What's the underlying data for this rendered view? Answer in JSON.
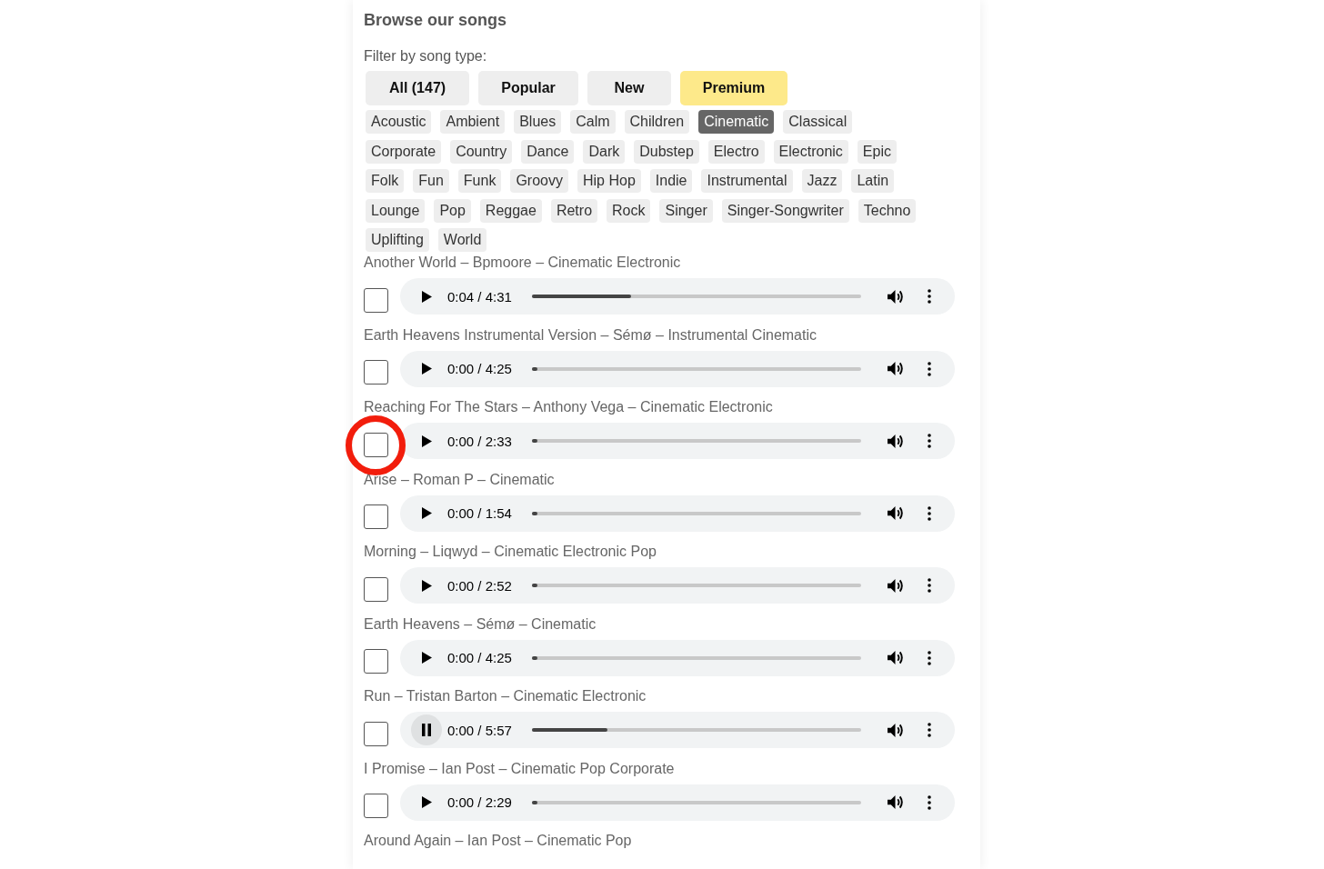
{
  "heading": "Browse our songs",
  "filter_label": "Filter by song type:",
  "type_buttons": [
    {
      "label": "All (147)",
      "selected": false
    },
    {
      "label": "Popular",
      "selected": false
    },
    {
      "label": "New",
      "selected": false
    },
    {
      "label": "Premium",
      "selected": true
    }
  ],
  "genre_rows": [
    [
      {
        "label": "Acoustic",
        "selected": false
      },
      {
        "label": "Ambient",
        "selected": false
      },
      {
        "label": "Blues",
        "selected": false
      },
      {
        "label": "Calm",
        "selected": false
      },
      {
        "label": "Children",
        "selected": false
      },
      {
        "label": "Cinematic",
        "selected": true
      },
      {
        "label": "Classical",
        "selected": false
      }
    ],
    [
      {
        "label": "Corporate",
        "selected": false
      },
      {
        "label": "Country",
        "selected": false
      },
      {
        "label": "Dance",
        "selected": false
      },
      {
        "label": "Dark",
        "selected": false
      },
      {
        "label": "Dubstep",
        "selected": false
      },
      {
        "label": "Electro",
        "selected": false
      },
      {
        "label": "Electronic",
        "selected": false
      },
      {
        "label": "Epic",
        "selected": false
      }
    ],
    [
      {
        "label": "Folk",
        "selected": false
      },
      {
        "label": "Fun",
        "selected": false
      },
      {
        "label": "Funk",
        "selected": false
      },
      {
        "label": "Groovy",
        "selected": false
      },
      {
        "label": "Hip Hop",
        "selected": false
      },
      {
        "label": "Indie",
        "selected": false
      },
      {
        "label": "Instrumental",
        "selected": false
      },
      {
        "label": "Jazz",
        "selected": false
      },
      {
        "label": "Latin",
        "selected": false
      }
    ],
    [
      {
        "label": "Lounge",
        "selected": false
      },
      {
        "label": "Pop",
        "selected": false
      },
      {
        "label": "Reggae",
        "selected": false
      },
      {
        "label": "Retro",
        "selected": false
      },
      {
        "label": "Rock",
        "selected": false
      },
      {
        "label": "Singer",
        "selected": false
      },
      {
        "label": "Singer-Songwriter",
        "selected": false
      },
      {
        "label": "Techno",
        "selected": false
      }
    ],
    [
      {
        "label": "Uplifting",
        "selected": false
      },
      {
        "label": "World",
        "selected": false
      }
    ]
  ],
  "songs": [
    {
      "title": "Another World – Bpmoore – Cinematic Electronic",
      "checked": false,
      "circled": false,
      "playing": false,
      "time": "0:04 / 4:31",
      "level": 0.3
    },
    {
      "title": "Earth Heavens Instrumental Version – Sémø – Instrumental Cinematic",
      "checked": false,
      "circled": false,
      "playing": false,
      "time": "0:00 / 4:25",
      "level": 0.01
    },
    {
      "title": "Reaching For The Stars – Anthony Vega – Cinematic Electronic",
      "checked": false,
      "circled": true,
      "playing": false,
      "time": "0:00 / 2:33",
      "level": 0.01
    },
    {
      "title": "Arise – Roman P – Cinematic",
      "checked": false,
      "circled": false,
      "playing": false,
      "time": "0:00 / 1:54",
      "level": 0.01
    },
    {
      "title": "Morning – Liqwyd – Cinematic Electronic Pop",
      "checked": false,
      "circled": false,
      "playing": false,
      "time": "0:00 / 2:52",
      "level": 0.01
    },
    {
      "title": "Earth Heavens – Sémø – Cinematic",
      "checked": false,
      "circled": false,
      "playing": false,
      "time": "0:00 / 4:25",
      "level": 0.01
    },
    {
      "title": "Run – Tristan Barton – Cinematic Electronic",
      "checked": false,
      "circled": false,
      "playing": true,
      "time": "0:00 / 5:57",
      "level": 0.23
    },
    {
      "title": "I Promise – Ian Post – Cinematic Pop Corporate",
      "checked": false,
      "circled": false,
      "playing": false,
      "time": "0:00 / 2:29",
      "level": 0.01
    },
    {
      "title": "Around Again – Ian Post – Cinematic Pop"
    }
  ]
}
